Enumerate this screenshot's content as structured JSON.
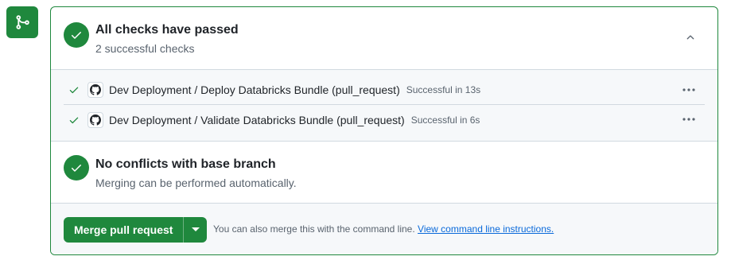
{
  "sidebar_icon": {
    "name": "git-merge-icon",
    "color": "#1f883d"
  },
  "checks": {
    "title": "All checks have passed",
    "subtitle": "2 successful checks",
    "collapse_icon": "chevron-up-icon",
    "items": [
      {
        "name": "Dev Deployment / Deploy Databricks Bundle (pull_request)",
        "status": "Successful in 13s",
        "icon": "github-logo-icon"
      },
      {
        "name": "Dev Deployment / Validate Databricks Bundle (pull_request)",
        "status": "Successful in 6s",
        "icon": "github-logo-icon"
      }
    ]
  },
  "conflicts": {
    "title": "No conflicts with base branch",
    "subtitle": "Merging can be performed automatically."
  },
  "merge": {
    "button_label": "Merge pull request",
    "note": "You can also merge this with the command line.",
    "link_text": "View command line instructions."
  },
  "colors": {
    "success": "#1f883d",
    "link": "#0969da",
    "muted": "#59636e"
  }
}
